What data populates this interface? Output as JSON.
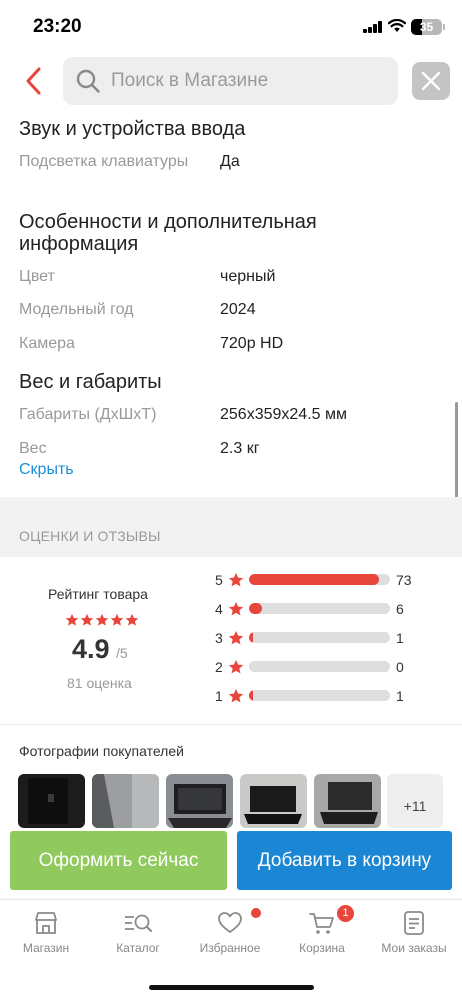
{
  "status_bar": {
    "time": "23:20",
    "battery": "35"
  },
  "search": {
    "placeholder": "Поиск в Магазине"
  },
  "specs": {
    "section_input": {
      "title": "Звук и устройства ввода",
      "rows": [
        {
          "label": "Подсветка клавиатуры",
          "value": "Да"
        }
      ]
    },
    "section_features": {
      "title": "Особенности и дополнительная информация",
      "rows": [
        {
          "label": "Цвет",
          "value": "черный"
        },
        {
          "label": "Модельный год",
          "value": "2024"
        },
        {
          "label": "Камера",
          "value": "720p HD"
        }
      ]
    },
    "section_dimensions": {
      "title": "Вес и габариты",
      "rows": [
        {
          "label": "Габариты (ДхШхТ)",
          "value": "256x359x24.5 мм"
        },
        {
          "label": "Вес",
          "value": "2.3 кг"
        }
      ]
    },
    "hide_link": "Скрыть"
  },
  "reviews": {
    "section_title": "ОЦЕНКИ И ОТЗЫВЫ",
    "rating_title": "Рейтинг товара",
    "average": "4.9",
    "average_of": "/5",
    "count_label": "81 оценка",
    "star_color": "#e8453c",
    "breakdown": [
      {
        "stars": "5",
        "count": "73",
        "fraction": 0.925
      },
      {
        "stars": "4",
        "count": "6",
        "fraction": 0.09
      },
      {
        "stars": "3",
        "count": "1",
        "fraction": 0.02
      },
      {
        "stars": "2",
        "count": "0",
        "fraction": 0.0
      },
      {
        "stars": "1",
        "count": "1",
        "fraction": 0.02
      }
    ]
  },
  "photos": {
    "title": "Фотографии покупателей",
    "more_label": "+11"
  },
  "actions": {
    "buy_now": "Оформить сейчас",
    "add_to_cart": "Добавить в корзину"
  },
  "tabbar": {
    "items": [
      {
        "label": "Магазин",
        "icon": "store-icon"
      },
      {
        "label": "Каталог",
        "icon": "catalog-icon"
      },
      {
        "label": "Избранное",
        "icon": "heart-icon"
      },
      {
        "label": "Корзина",
        "icon": "cart-icon",
        "badge": "1"
      },
      {
        "label": "Мои заказы",
        "icon": "orders-icon"
      }
    ]
  },
  "colors": {
    "accent_red": "#e8453c",
    "buy_green": "#90c95e",
    "cart_blue": "#1b86d3",
    "link_blue": "#1a8fd6"
  }
}
